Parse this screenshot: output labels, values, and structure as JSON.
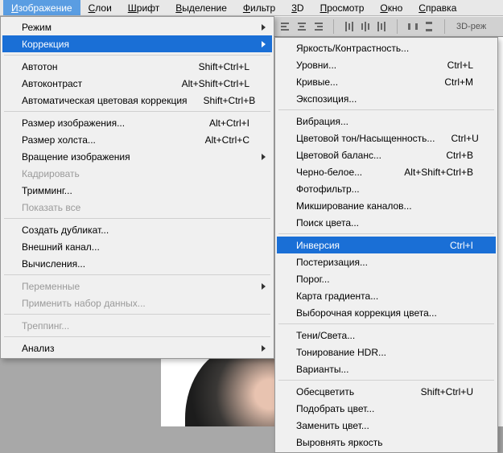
{
  "menubar": {
    "items": [
      {
        "label": "Изображение",
        "u": "И",
        "rest": "зображение",
        "active": true
      },
      {
        "label": "Слои",
        "u": "С",
        "rest": "лои"
      },
      {
        "label": "Шрифт",
        "u": "Ш",
        "rest": "рифт"
      },
      {
        "label": "Выделение",
        "u": "В",
        "rest": "ыделение"
      },
      {
        "label": "Фильтр",
        "u": "Ф",
        "rest": "ильтр"
      },
      {
        "label": "3D",
        "u": "3",
        "rest": "D"
      },
      {
        "label": "Просмотр",
        "u": "П",
        "rest": "росмотр"
      },
      {
        "label": "Окно",
        "u": "О",
        "rest": "кно"
      },
      {
        "label": "Справка",
        "u": "С",
        "rest": "правка"
      }
    ]
  },
  "toolbar": {
    "text3d": "3D-реж"
  },
  "menu1": [
    {
      "type": "item",
      "label": "Режим",
      "submenu": true
    },
    {
      "type": "item",
      "label": "Коррекция",
      "submenu": true,
      "highlight": true
    },
    {
      "type": "sep"
    },
    {
      "type": "item",
      "label": "Автотон",
      "shortcut": "Shift+Ctrl+L"
    },
    {
      "type": "item",
      "label": "Автоконтраст",
      "shortcut": "Alt+Shift+Ctrl+L"
    },
    {
      "type": "item",
      "label": "Автоматическая цветовая коррекция",
      "shortcut": "Shift+Ctrl+B"
    },
    {
      "type": "sep"
    },
    {
      "type": "item",
      "label": "Размер изображения...",
      "shortcut": "Alt+Ctrl+I"
    },
    {
      "type": "item",
      "label": "Размер холста...",
      "shortcut": "Alt+Ctrl+C"
    },
    {
      "type": "item",
      "label": "Вращение изображения",
      "submenu": true
    },
    {
      "type": "item",
      "label": "Кадрировать",
      "disabled": true
    },
    {
      "type": "item",
      "label": "Тримминг..."
    },
    {
      "type": "item",
      "label": "Показать все",
      "disabled": true
    },
    {
      "type": "sep"
    },
    {
      "type": "item",
      "label": "Создать дубликат..."
    },
    {
      "type": "item",
      "label": "Внешний канал..."
    },
    {
      "type": "item",
      "label": "Вычисления..."
    },
    {
      "type": "sep"
    },
    {
      "type": "item",
      "label": "Переменные",
      "submenu": true,
      "disabled": true
    },
    {
      "type": "item",
      "label": "Применить набор данных...",
      "disabled": true
    },
    {
      "type": "sep"
    },
    {
      "type": "item",
      "label": "Треппинг...",
      "disabled": true
    },
    {
      "type": "sep"
    },
    {
      "type": "item",
      "label": "Анализ",
      "submenu": true
    }
  ],
  "menu2": [
    {
      "type": "item",
      "label": "Яркость/Контрастность..."
    },
    {
      "type": "item",
      "label": "Уровни...",
      "shortcut": "Ctrl+L"
    },
    {
      "type": "item",
      "label": "Кривые...",
      "shortcut": "Ctrl+M"
    },
    {
      "type": "item",
      "label": "Экспозиция..."
    },
    {
      "type": "sep"
    },
    {
      "type": "item",
      "label": "Вибрация..."
    },
    {
      "type": "item",
      "label": "Цветовой тон/Насыщенность...",
      "shortcut": "Ctrl+U"
    },
    {
      "type": "item",
      "label": "Цветовой баланс...",
      "shortcut": "Ctrl+B"
    },
    {
      "type": "item",
      "label": "Черно-белое...",
      "shortcut": "Alt+Shift+Ctrl+B"
    },
    {
      "type": "item",
      "label": "Фотофильтр..."
    },
    {
      "type": "item",
      "label": "Микширование каналов..."
    },
    {
      "type": "item",
      "label": "Поиск цвета..."
    },
    {
      "type": "sep"
    },
    {
      "type": "item",
      "label": "Инверсия",
      "shortcut": "Ctrl+I",
      "highlight": true
    },
    {
      "type": "item",
      "label": "Постеризация..."
    },
    {
      "type": "item",
      "label": "Порог..."
    },
    {
      "type": "item",
      "label": "Карта градиента..."
    },
    {
      "type": "item",
      "label": "Выборочная коррекция цвета..."
    },
    {
      "type": "sep"
    },
    {
      "type": "item",
      "label": "Тени/Света..."
    },
    {
      "type": "item",
      "label": "Тонирование HDR..."
    },
    {
      "type": "item",
      "label": "Варианты..."
    },
    {
      "type": "sep"
    },
    {
      "type": "item",
      "label": "Обесцветить",
      "shortcut": "Shift+Ctrl+U"
    },
    {
      "type": "item",
      "label": "Подобрать цвет..."
    },
    {
      "type": "item",
      "label": "Заменить цвет..."
    },
    {
      "type": "item",
      "label": "Выровнять яркость"
    }
  ]
}
